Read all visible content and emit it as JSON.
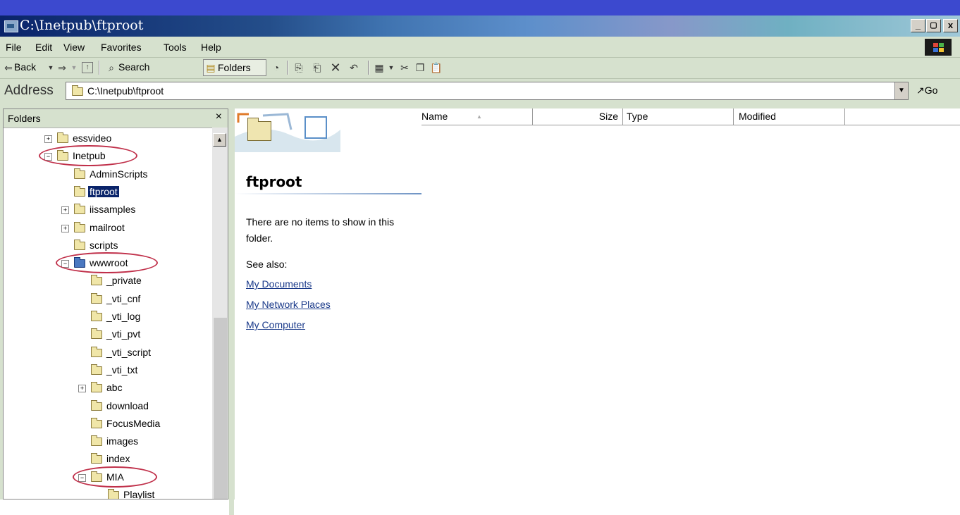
{
  "window": {
    "title": "C:\\Inetpub\\ftproot",
    "buttons": {
      "minimize": "_",
      "maximize": "Ē",
      "close": "x"
    }
  },
  "menu": [
    "File",
    "Edit",
    "View",
    "Favorites",
    "Tools",
    "Help"
  ],
  "toolbar": {
    "back_label": "Back",
    "search_label": "Search",
    "folders_label": "Folders"
  },
  "address": {
    "label": "Address",
    "value": "C:\\Inetpub\\ftproot",
    "go_label": "Go"
  },
  "folders_pane": {
    "title": "Folders",
    "close_glyph": "×",
    "tree": [
      {
        "label": "essvideo",
        "toggle": "+",
        "selected": false
      },
      {
        "label": "Inetpub",
        "toggle": "−",
        "selected": false,
        "highlighted": true
      },
      {
        "label": "AdminScripts",
        "toggle": "",
        "selected": false
      },
      {
        "label": "ftproot",
        "toggle": "",
        "selected": true
      },
      {
        "label": "iissamples",
        "toggle": "+",
        "selected": false
      },
      {
        "label": "mailroot",
        "toggle": "+",
        "selected": false
      },
      {
        "label": "scripts",
        "toggle": "",
        "selected": false
      },
      {
        "label": "wwwroot",
        "toggle": "−",
        "selected": false,
        "highlighted": true,
        "icon": "web-folder-icon"
      },
      {
        "label": "_private",
        "toggle": "",
        "selected": false
      },
      {
        "label": "_vti_cnf",
        "toggle": "",
        "selected": false
      },
      {
        "label": "_vti_log",
        "toggle": "",
        "selected": false
      },
      {
        "label": "_vti_pvt",
        "toggle": "",
        "selected": false
      },
      {
        "label": "_vti_script",
        "toggle": "",
        "selected": false
      },
      {
        "label": "_vti_txt",
        "toggle": "",
        "selected": false
      },
      {
        "label": "abc",
        "toggle": "+",
        "selected": false
      },
      {
        "label": "download",
        "toggle": "",
        "selected": false
      },
      {
        "label": "FocusMedia",
        "toggle": "",
        "selected": false
      },
      {
        "label": "images",
        "toggle": "",
        "selected": false
      },
      {
        "label": "index",
        "toggle": "",
        "selected": false
      },
      {
        "label": "MIA",
        "toggle": "−",
        "selected": false,
        "highlighted": true
      },
      {
        "label": "Playlist",
        "toggle": "",
        "selected": false
      }
    ]
  },
  "webview": {
    "title": "ftproot",
    "message": "There are no items to show in this folder.",
    "see_also": "See also:",
    "links": [
      "My Documents",
      "My Network Places",
      "My Computer"
    ]
  },
  "columns": {
    "name": "Name",
    "name_sort": "▲",
    "size": "Size",
    "type": "Type",
    "modified": "Modified"
  },
  "colors": {
    "highlight_oval": "#c0304a",
    "selection": "#0a246a",
    "chrome": "#d6e1ce"
  }
}
